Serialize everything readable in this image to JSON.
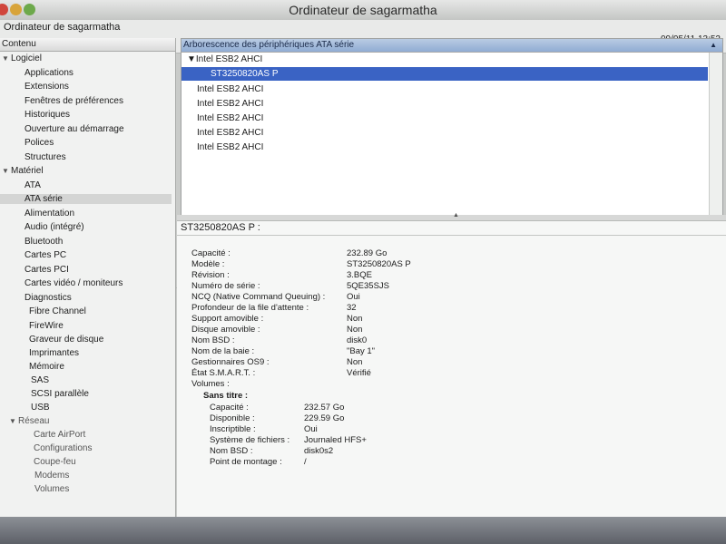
{
  "window": {
    "title": "Ordinateur de sagarmatha"
  },
  "toolbar": {
    "computer_name": "Ordinateur de sagarmatha",
    "datetime": "09/05/11 13:52"
  },
  "sidebar": {
    "header": "Contenu",
    "groups": [
      {
        "label": "Logiciel",
        "items": [
          "Applications",
          "Extensions",
          "Fenêtres de préférences",
          "Historiques",
          "Ouverture au démarrage",
          "Polices",
          "Structures"
        ]
      },
      {
        "label": "Matériel",
        "items": [
          "ATA",
          "ATA série",
          "Alimentation",
          "Audio (intégré)",
          "Bluetooth",
          "Cartes PC",
          "Cartes PCI",
          "Cartes vidéo / moniteurs",
          "Diagnostics",
          "Fibre Channel",
          "FireWire",
          "Graveur de disque",
          "Imprimantes",
          "Mémoire",
          "SAS",
          "SCSI parallèle",
          "USB"
        ]
      },
      {
        "label": "Réseau",
        "items": [
          "Carte AirPort",
          "Configurations",
          "Coupe-feu",
          "Modems",
          "Volumes"
        ]
      }
    ],
    "selected": "ATA série"
  },
  "device_tree": {
    "header": "Arborescence des périphériques ATA série",
    "rows": [
      {
        "label": "Intel ESB2 AHCI",
        "expanded": true
      },
      {
        "label": "ST3250820AS P",
        "selected": true
      },
      {
        "label": "Intel ESB2 AHCI"
      },
      {
        "label": "Intel ESB2 AHCI"
      },
      {
        "label": "Intel ESB2 AHCI"
      },
      {
        "label": "Intel ESB2 AHCI"
      },
      {
        "label": "Intel ESB2 AHCI"
      }
    ]
  },
  "details": {
    "title": "ST3250820AS P :",
    "properties": [
      {
        "label": "Capacité :",
        "value": "232.89 Go"
      },
      {
        "label": "Modèle :",
        "value": "ST3250820AS P"
      },
      {
        "label": "Révision :",
        "value": "3.BQE"
      },
      {
        "label": "Numéro de série :",
        "value": "5QE35SJS"
      },
      {
        "label": "NCQ (Native Command Queuing) :",
        "value": "Oui"
      },
      {
        "label": "Profondeur de la file d'attente :",
        "value": "32"
      },
      {
        "label": "Support amovible :",
        "value": "Non"
      },
      {
        "label": "Disque amovible :",
        "value": "Non"
      },
      {
        "label": "Nom BSD :",
        "value": "disk0"
      },
      {
        "label": "Nom de la baie :",
        "value": "\"Bay 1\""
      },
      {
        "label": "Gestionnaires OS9 :",
        "value": "Non"
      },
      {
        "label": "État S.M.A.R.T. :",
        "value": "Vérifié"
      }
    ],
    "volumes_label": "Volumes :",
    "volume": {
      "name": "Sans titre :",
      "properties": [
        {
          "label": "Capacité :",
          "value": "232.57 Go"
        },
        {
          "label": "Disponible :",
          "value": "229.59 Go"
        },
        {
          "label": "Inscriptible :",
          "value": "Oui"
        },
        {
          "label": "Système de fichiers :",
          "value": "Journaled HFS+"
        },
        {
          "label": "Nom BSD :",
          "value": "disk0s2"
        },
        {
          "label": "Point de montage :",
          "value": "/"
        }
      ]
    }
  },
  "icons": {
    "expand": "disclosure-triangle-icon",
    "sort": "sort-triangle-icon",
    "splitter": "splitter-handle-icon"
  }
}
